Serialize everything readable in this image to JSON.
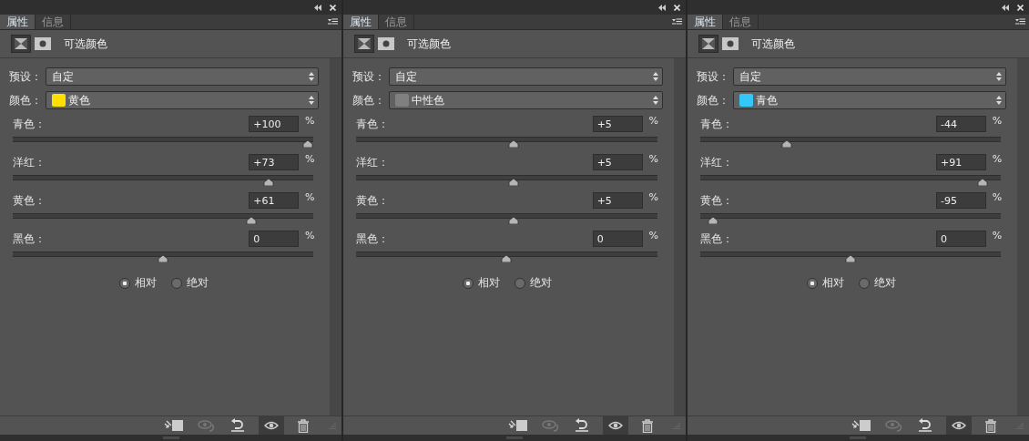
{
  "panels": [
    {
      "tabs": [
        {
          "label": "属性",
          "selected": true
        },
        {
          "label": "信息",
          "selected": false
        }
      ],
      "title": "可选颜色",
      "preset": {
        "label": "预设：",
        "value": "自定"
      },
      "colors": {
        "label": "颜色：",
        "value": "黄色",
        "color": "#ffe000"
      },
      "sliders": [
        {
          "label": "青色：",
          "value": "+100",
          "unit": "%",
          "level": 1
        },
        {
          "label": "洋红：",
          "value": "+73",
          "unit": "%",
          "level": 0.865
        },
        {
          "label": "黄色：",
          "value": "+61",
          "unit": "%",
          "level": 0.805
        },
        {
          "label": "黑色：",
          "value": "0",
          "unit": "%",
          "level": 0.5
        }
      ],
      "modes": [
        {
          "label": "相对",
          "selected": true
        },
        {
          "label": "绝对",
          "selected": false
        }
      ],
      "visible": true
    },
    {
      "tabs": [
        {
          "label": "属性",
          "selected": true
        },
        {
          "label": "信息",
          "selected": false
        }
      ],
      "title": "可选颜色",
      "preset": {
        "label": "预设：",
        "value": "自定"
      },
      "colors": {
        "label": "颜色：",
        "value": "中性色",
        "color": "#808080"
      },
      "sliders": [
        {
          "label": "青色：",
          "value": "+5",
          "unit": "%",
          "level": 0.525
        },
        {
          "label": "洋红：",
          "value": "+5",
          "unit": "%",
          "level": 0.525
        },
        {
          "label": "黄色：",
          "value": "+5",
          "unit": "%",
          "level": 0.525
        },
        {
          "label": "黑色：",
          "value": "0",
          "unit": "%",
          "level": 0.5
        }
      ],
      "modes": [
        {
          "label": "相对",
          "selected": true
        },
        {
          "label": "绝对",
          "selected": false
        }
      ],
      "visible": true
    },
    {
      "tabs": [
        {
          "label": "属性",
          "selected": true
        },
        {
          "label": "信息",
          "selected": false
        }
      ],
      "title": "可选颜色",
      "preset": {
        "label": "预设：",
        "value": "自定"
      },
      "colors": {
        "label": "颜色：",
        "value": "青色",
        "color": "#33c8f8"
      },
      "sliders": [
        {
          "label": "青色：",
          "value": "-44",
          "unit": "%",
          "level": 0.28
        },
        {
          "label": "洋红：",
          "value": "+91",
          "unit": "%",
          "level": 0.955
        },
        {
          "label": "黄色：",
          "value": "-95",
          "unit": "%",
          "level": 0.025
        },
        {
          "label": "黑色：",
          "value": "0",
          "unit": "%",
          "level": 0.5
        }
      ],
      "modes": [
        {
          "label": "相对",
          "selected": true
        },
        {
          "label": "绝对",
          "selected": false
        }
      ],
      "visible": true
    }
  ]
}
